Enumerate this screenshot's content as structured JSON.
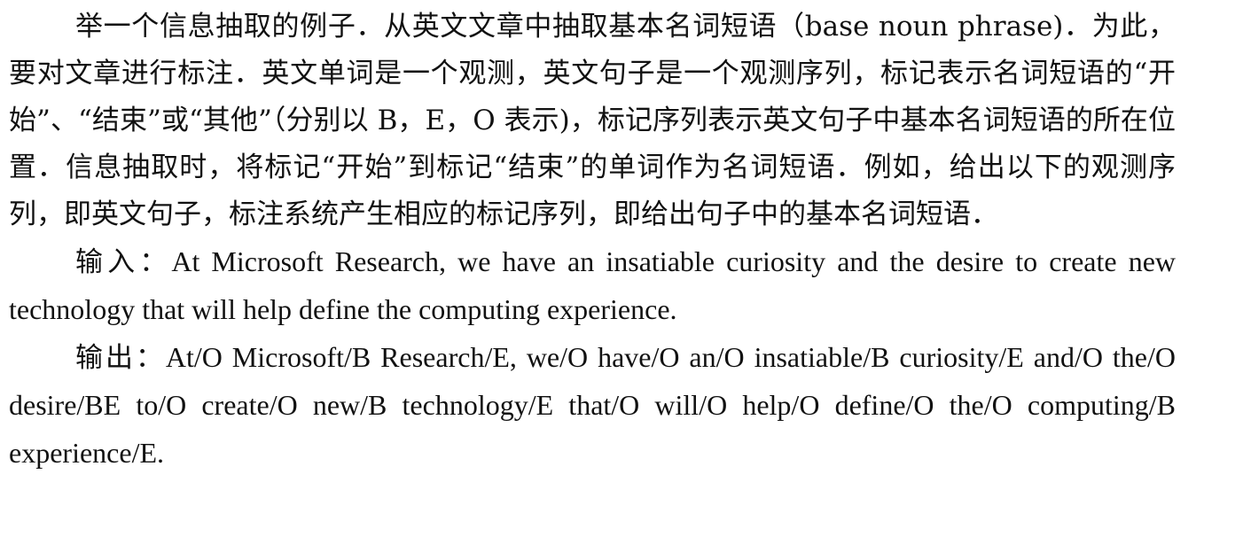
{
  "document": {
    "paragraph_1": "举一个信息抽取的例子．从英文文章中抽取基本名词短语（base noun phrase)．为此，要对文章进行标注．英文单词是一个观测，英文句子是一个观测序列，标记表示名词短语的“开始”、“结束”或“其他”（分别以 B，E，O 表示)，标记序列表示英文句子中基本名词短语的所在位置．信息抽取时，将标记“开始”到标记“结束”的单词作为名词短语．例如，给出以下的观测序列，即英文句子，标注系统产生相应的标记序列，即给出句子中的基本名词短语．",
    "input": {
      "label": "输入：",
      "text": "At Microsoft Research, we have an insatiable curiosity and the desire to create new technology that will help define the computing experience."
    },
    "output": {
      "label": "输出：",
      "text": "At/O Microsoft/B Research/E, we/O have/O an/O insatiable/B curiosity/E and/O the/O desire/BE to/O create/O new/B technology/E that/O will/O help/O define/O the/O computing/B experience/E."
    }
  }
}
